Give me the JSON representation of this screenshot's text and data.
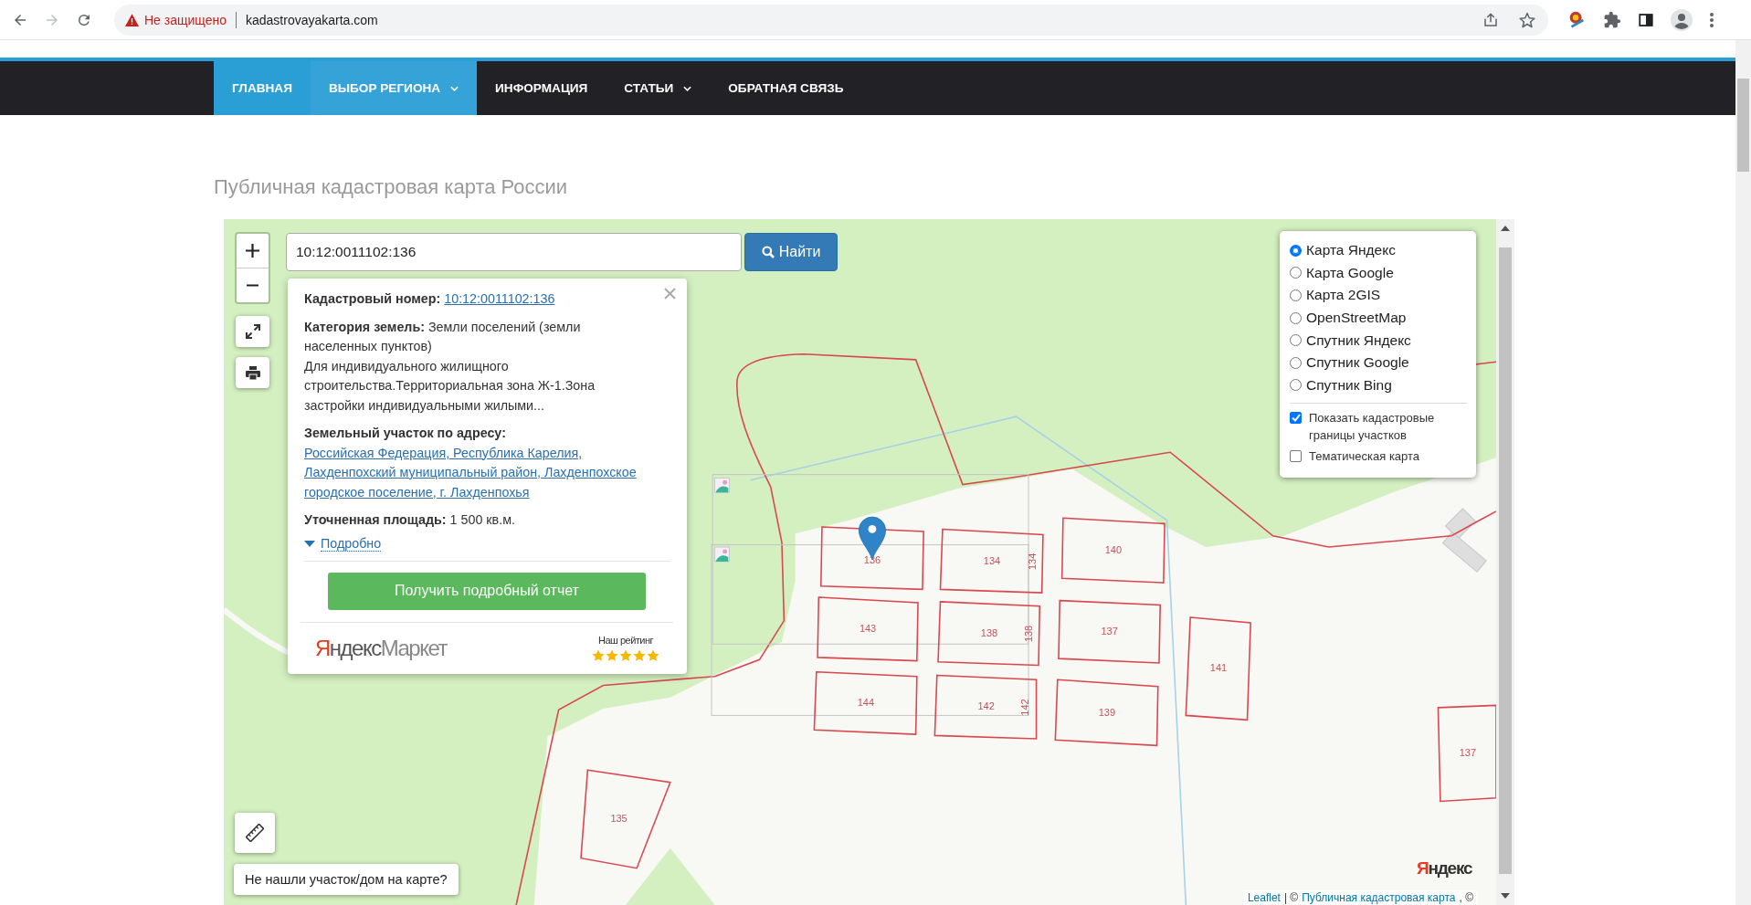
{
  "browser": {
    "security_label": "Не защищено",
    "url": "kadastrovayakarta.com"
  },
  "nav": [
    {
      "label": "ГЛАВНАЯ",
      "selected": true,
      "has_menu": false
    },
    {
      "label": "ВЫБОР РЕГИОНА",
      "selected": true,
      "has_menu": true
    },
    {
      "label": "ИНФОРМАЦИЯ",
      "selected": false,
      "has_menu": false
    },
    {
      "label": "СТАТЬИ",
      "selected": false,
      "has_menu": true
    },
    {
      "label": "ОБРАТНАЯ СВЯЗЬ",
      "selected": false,
      "has_menu": false
    }
  ],
  "page_title": "Публичная кадастровая карта России",
  "map": {
    "search": {
      "value": "10:12:0011102:136",
      "button": "Найти"
    },
    "popup": {
      "fields": [
        {
          "kind": "link",
          "label": "Кадастровый номер:",
          "value": "10:12:0011102:136"
        },
        {
          "kind": "text",
          "label": "Категория земель:",
          "value": "Земли поселений (земли населенных пунктов)"
        },
        {
          "kind": "note",
          "value": "Для индивидуального жилищного строительства.Территориальная зона Ж-1.Зона застройки индивидуальными жилыми..."
        },
        {
          "kind": "link",
          "label": "Земельный участок по адресу:",
          "value": "Российская Федерация, Республика Карелия, Лахденпохский муниципальный район, Лахденпохское городское поселение, г. Лахденпохья"
        },
        {
          "kind": "text",
          "label": "Уточненная площадь:",
          "value": "1 500 кв.м."
        }
      ],
      "details_link": "Подробно",
      "report_button": "Получить подробный отчет",
      "market_logo": {
        "brand": "Яндекс",
        "product": "Маркет"
      },
      "rating": {
        "caption": "Наш рейтинг",
        "stars": 5
      }
    },
    "layers": [
      {
        "label": "Карта Яндекс",
        "selected": true
      },
      {
        "label": "Карта Google",
        "selected": false
      },
      {
        "label": "Карта 2GIS",
        "selected": false
      },
      {
        "label": "OpenStreetMap",
        "selected": false
      },
      {
        "label": "Спутник Яндекс",
        "selected": false
      },
      {
        "label": "Спутник Google",
        "selected": false
      },
      {
        "label": "Спутник Bing",
        "selected": false
      }
    ],
    "overlays": [
      {
        "label": "Показать кадастровые границы участков",
        "checked": true
      },
      {
        "label": "Тематическая карта",
        "checked": false
      }
    ],
    "parcels": [
      {
        "number": "136"
      },
      {
        "number": "134",
        "side_label": "134"
      },
      {
        "number": "140"
      },
      {
        "number": "143"
      },
      {
        "number": "138",
        "side_label": "138"
      },
      {
        "number": "137"
      },
      {
        "number": "141"
      },
      {
        "number": "144"
      },
      {
        "number": "142",
        "side_label": "142"
      },
      {
        "number": "139"
      },
      {
        "number": "137"
      },
      {
        "number": "135"
      }
    ],
    "not_found_button": "Не нашли участок/дом на карте?",
    "map_logo": "Яндекс",
    "attribution": [
      {
        "kind": "link",
        "text": "Leaflet"
      },
      {
        "kind": "text",
        "text": "| ©"
      },
      {
        "kind": "link",
        "text": "Публичная кадастровая карта"
      },
      {
        "kind": "text",
        "text": ", ©"
      }
    ]
  }
}
